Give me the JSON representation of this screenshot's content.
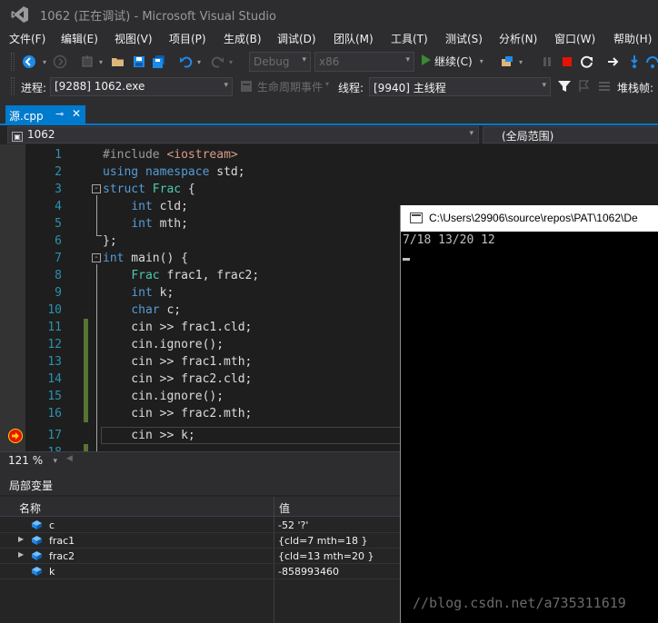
{
  "window": {
    "title": "1062 (正在调试) - Microsoft Visual Studio"
  },
  "menu": [
    "文件(F)",
    "编辑(E)",
    "视图(V)",
    "项目(P)",
    "生成(B)",
    "调试(D)",
    "团队(M)",
    "工具(T)",
    "测试(S)",
    "分析(N)",
    "窗口(W)",
    "帮助(H)"
  ],
  "toolbar": {
    "config": "Debug",
    "platform": "x86",
    "continue_label": "继续(C)"
  },
  "debug_location": {
    "process_label": "进程:",
    "process_value": "[9288] 1062.exe",
    "lifecycle_label": "生命周期事件",
    "thread_label": "线程:",
    "thread_value": "[9940] 主线程",
    "stackframe_label": "堆栈帧:"
  },
  "tab": {
    "label": "源.cpp"
  },
  "navigation": {
    "project": "1062",
    "scope": "(全局范围)"
  },
  "editor": {
    "zoom": "121 %",
    "current_line": 17
  },
  "locals": {
    "title": "局部变量",
    "col_name": "名称",
    "col_value": "值",
    "rows": [
      {
        "name": "c",
        "value": "-52 '?'",
        "expandable": false
      },
      {
        "name": "frac1",
        "value": "{cld=7 mth=18 }",
        "expandable": true
      },
      {
        "name": "frac2",
        "value": "{cld=13 mth=20 }",
        "expandable": true
      },
      {
        "name": "k",
        "value": "-858993460",
        "expandable": false
      }
    ]
  },
  "console": {
    "title": "C:\\Users\\29906\\source\\repos\\PAT\\1062\\De",
    "output": "7/18 13/20 12",
    "watermark": "//blog.csdn.net/a735311619"
  },
  "colors": {
    "accent": "#007acc",
    "keyword": "#569cd6",
    "type": "#4ec9b0",
    "line_number": "#2b91af",
    "change_marker": "#577430"
  }
}
